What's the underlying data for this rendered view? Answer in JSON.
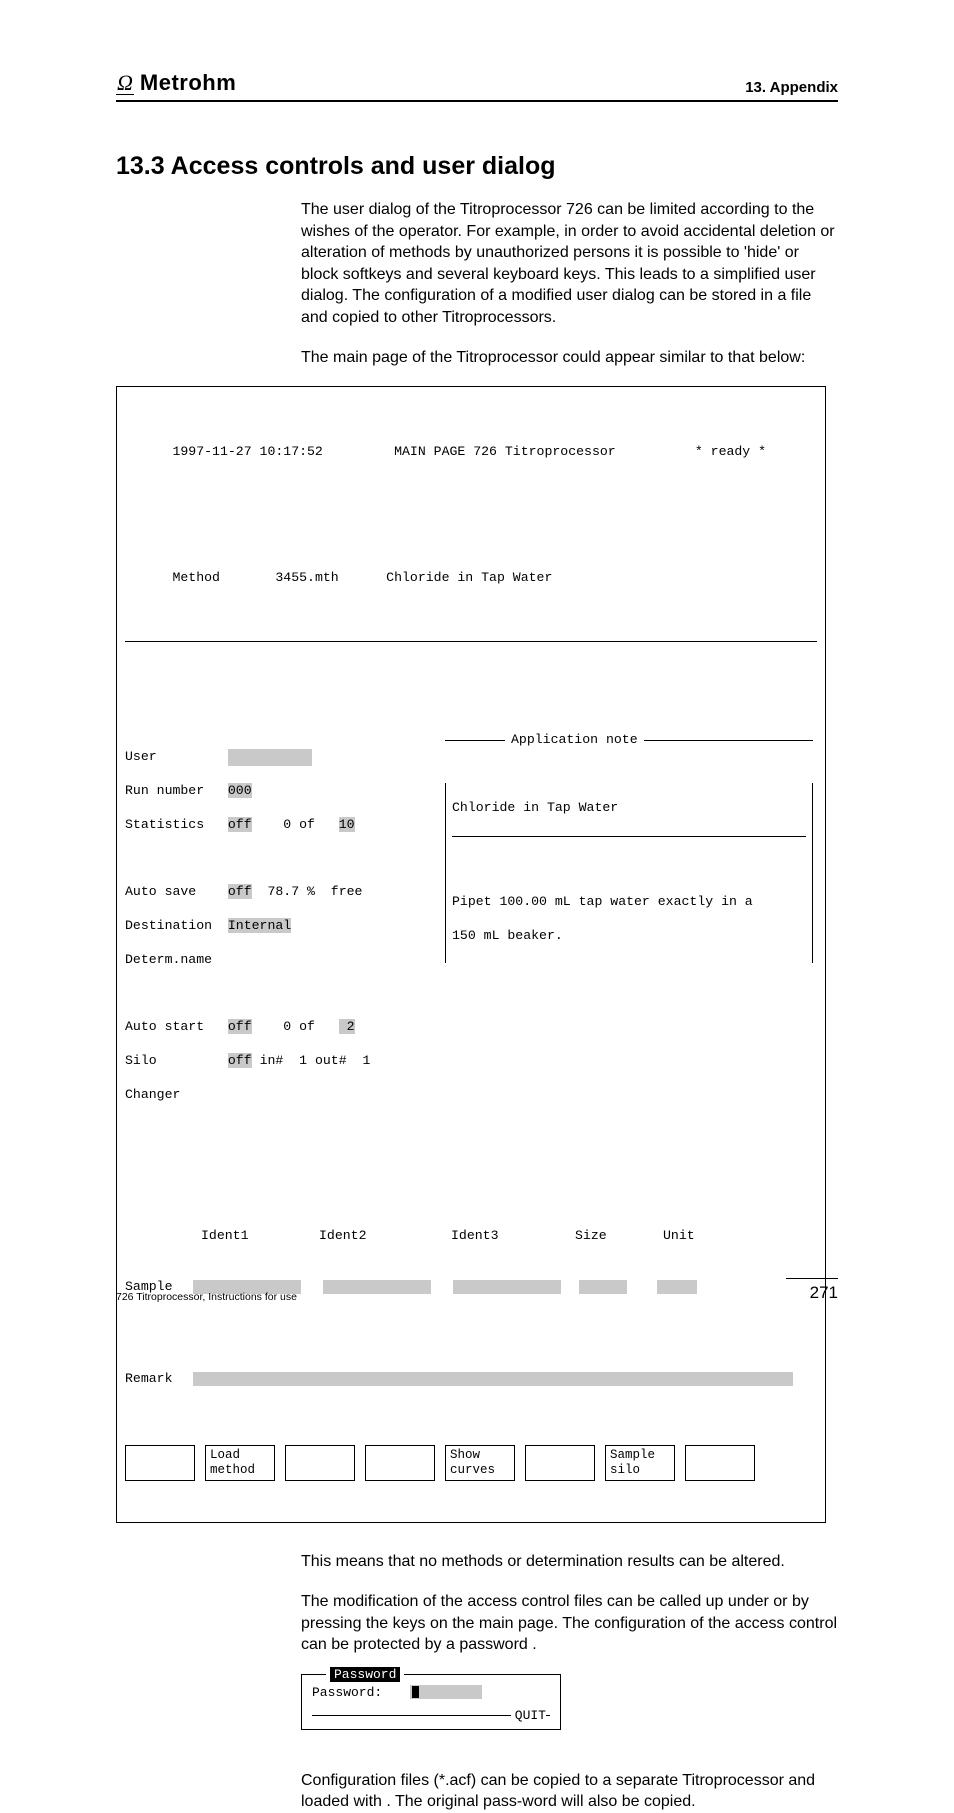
{
  "header": {
    "brand_symbol": "Ω",
    "brand": "Metrohm",
    "section_label": "13. Appendix"
  },
  "title": "13.3  Access controls and user dialog",
  "para1": "The user dialog of the Titroprocessor 726 can be limited according to the wishes of the operator. For example, in order to avoid accidental deletion or alteration of methods by unauthorized persons it is possible to 'hide' or block softkeys and several keyboard keys. This leads to a simplified user dialog. The configuration of a modified user dialog can be stored in a file and copied to other Titroprocessors.",
  "para2": "The main page of the Titroprocessor could appear similar to that below:",
  "term": {
    "title_line": {
      "timestamp": "1997-11-27 10:17:52",
      "center": "MAIN PAGE 726 Titroprocessor",
      "status": "* ready *"
    },
    "method_label": "Method",
    "method_file": "3455.mth",
    "method_desc": "Chloride in Tap Water",
    "fields": {
      "user_label": "User",
      "run_label": "Run number",
      "run_value": "000",
      "stats_label": "Statistics",
      "stats_value": "off",
      "stats_of": "0 of",
      "stats_n": "10",
      "autosave_label": "Auto save",
      "autosave_value": "off",
      "autosave_pct": "78.7 %",
      "autosave_free": "free",
      "dest_label": "Destination",
      "dest_value": "Internal",
      "detname_label": "Determ.name",
      "autostart_label": "Auto start",
      "autostart_value": "off",
      "autostart_of": "0 of",
      "autostart_n": "2",
      "silo_label": "Silo",
      "silo_value": "off",
      "silo_in": "in#",
      "silo_in_n": "1",
      "silo_out": "out#",
      "silo_out_n": "1",
      "changer_label": "Changer"
    },
    "app_note": {
      "title": "Application note",
      "line1": "Chloride in Tap Water",
      "line2": "Pipet 100.00 mL tap water exactly in a",
      "line3": "150 mL beaker."
    },
    "idents": {
      "i1": "Ident1",
      "i2": "Ident2",
      "i3": "Ident3",
      "size": "Size",
      "unit": "Unit",
      "sample": "Sample",
      "remark": "Remark"
    },
    "softkeys": [
      "",
      "Load\nmethod",
      "",
      "",
      "Show\ncurves",
      "",
      "Sample\nsilo",
      ""
    ]
  },
  "para3": "This means that no methods or determination results can be altered.",
  "para4a": "The modification of the access control files can be called up under",
  "para4a_bold": "",
  "para4b_pre": "",
  "para4b_mid": " or by pressing the ",
  "para4b_post": " keys on the main page. The configuration of the access control can be protected by a password .",
  "password_box": {
    "legend": "Password",
    "label": "Password:",
    "quit": "QUIT"
  },
  "para5a": "Configuration files (*.acf) can be copied to a separate Titroprocessor and loaded with ",
  "para5b": ". The original pass-word will also be copied.",
  "footer": {
    "left": "726 Titroprocessor, Instructions for use",
    "page": "271"
  }
}
